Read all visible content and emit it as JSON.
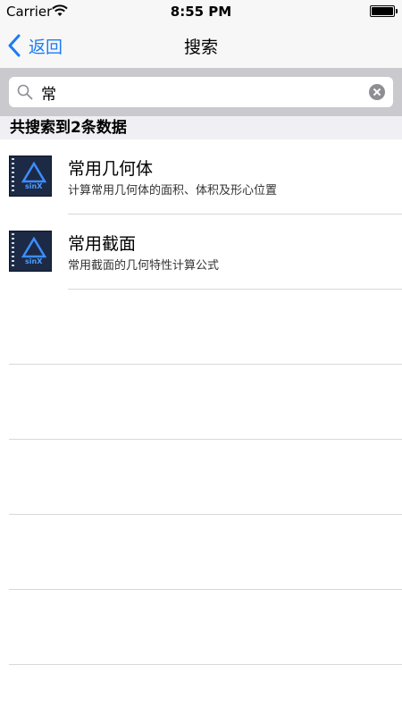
{
  "status_bar": {
    "carrier": "Carrier",
    "time": "8:55 PM"
  },
  "nav": {
    "back_label": "返回",
    "title": "搜索"
  },
  "search": {
    "query": "常"
  },
  "result_count": "共搜索到2条数据",
  "results": [
    {
      "title": "常用几何体",
      "subtitle": "计算常用几何体的面积、体积及形心位置",
      "thumb_label": "sinX"
    },
    {
      "title": "常用截面",
      "subtitle": "常用截面的几何特性计算公式",
      "thumb_label": "sinX"
    }
  ],
  "colors": {
    "accent": "#1a7cf5",
    "searchbar_bg": "#c9c9ce",
    "section_bg": "#efeff4"
  }
}
